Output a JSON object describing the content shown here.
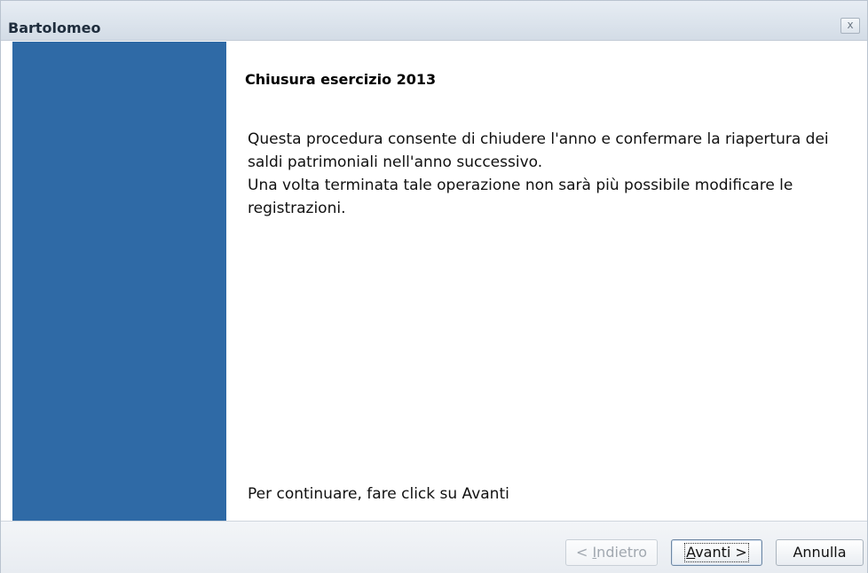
{
  "window": {
    "title": "Bartolomeo",
    "close_label": "x"
  },
  "wizard": {
    "heading": "Chiusura esercizio 2013",
    "description_lines": [
      "Questa procedura consente di chiudere l'anno e confermare la riapertura dei saldi patrimoniali nell'anno successivo.",
      "Una volta terminata tale operazione non sarà più possibile modificare le registrazioni."
    ],
    "continue_hint": "Per continuare, fare click su Avanti"
  },
  "buttons": {
    "back": {
      "prefix": "< ",
      "mnemonic": "I",
      "rest": "ndietro",
      "enabled": false
    },
    "next": {
      "mnemonic": "A",
      "rest": "vanti >",
      "enabled": true,
      "default": true
    },
    "cancel": {
      "label": "Annulla",
      "enabled": true
    }
  },
  "colors": {
    "sidebar": "#2f6aa6",
    "titlebar": "#dbe3ec",
    "disabled_text": "#a1a8b0"
  }
}
